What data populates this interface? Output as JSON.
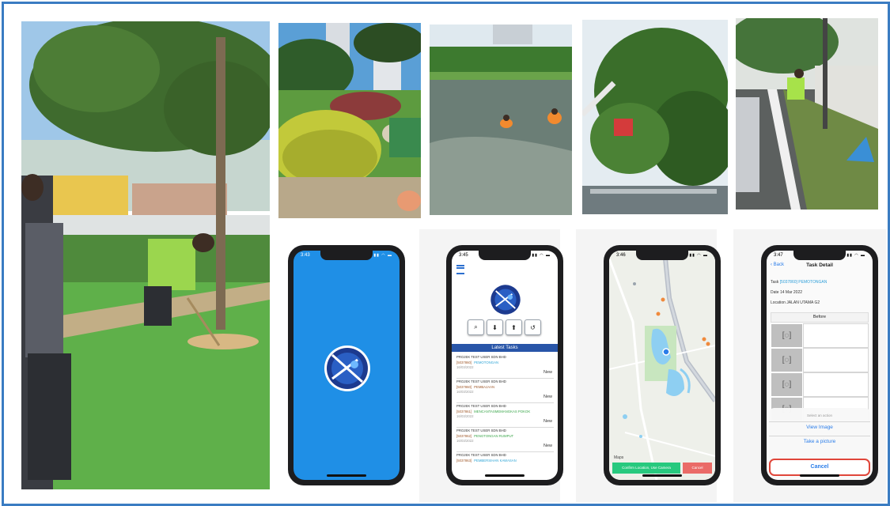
{
  "colors": {
    "frame_border": "#3a7cc2",
    "splash_bg": "#1f8fe6",
    "header_blue": "#2855a8",
    "link_blue": "#2b7de9",
    "confirm_green": "#27c97e",
    "cancel_red": "#ea6b67"
  },
  "photos": {
    "main": {
      "description_icon": "workers-trimming-grass-photo"
    },
    "shrub": {
      "description_icon": "worker-pruning-shrub-photo"
    },
    "pond": {
      "description_icon": "workers-cleaning-pond-photo"
    },
    "tree": {
      "description_icon": "tree-pruning-crane-photo"
    },
    "road": {
      "description_icon": "worker-cleaning-roadside-photo"
    }
  },
  "phones": {
    "splash": {
      "time": "3:43",
      "status_icons": "▮▮ ◠ ▬",
      "logo_icon": "app-logo-icon"
    },
    "home": {
      "time": "3:45",
      "tools": [
        "⌕",
        "⬇",
        "⬆",
        "↺"
      ],
      "latest_tasks_label": "Latest Tasks",
      "tasks": [
        {
          "company": "PROJEK TEST USER SDN BHD",
          "id": "[5037860]",
          "type": "PEMOTONGAN",
          "date": "16/03/2022",
          "status": "New"
        },
        {
          "company": "PROJEK TEST USER SDN BHD",
          "id": "[5037860]",
          "type": "PEMBAJAAN",
          "date": "16/03/2022",
          "status": "New"
        },
        {
          "company": "PROJEK TEST USER SDN BHD",
          "id": "[5037861]",
          "type": "MENCANTASMEMANGKAS POKOK",
          "date": "16/03/2022",
          "status": "New"
        },
        {
          "company": "PROJEK TEST USER SDN BHD",
          "id": "[5037862]",
          "type": "PENGTONGAN RUMPUT",
          "date": "16/03/2022",
          "status": "New"
        },
        {
          "company": "PROJEK TEST USER SDN BHD",
          "id": "[5037863]",
          "type": "PEMBERSIHAN KAWASAN",
          "date": "16/03/2022",
          "status": "New"
        }
      ]
    },
    "map": {
      "time": "3:46",
      "maps_label": "Maps",
      "confirm_label": "Confirm Location, Use Camera",
      "cancel_label": "Cancel"
    },
    "detail": {
      "time": "3:47",
      "back_label": "Back",
      "title": "Task Detail",
      "task_label": "Task",
      "task_value": "[5037860] PEMOTONGAN",
      "date_label": "Date",
      "date_value": "14 Mar 2022",
      "location_label": "Location",
      "location_value": "JALAN UTAMA G2",
      "before_label": "Before",
      "sheet_header": "Select an action",
      "view_image": "View Image",
      "take_picture": "Take a picture",
      "cancel": "Cancel"
    }
  }
}
